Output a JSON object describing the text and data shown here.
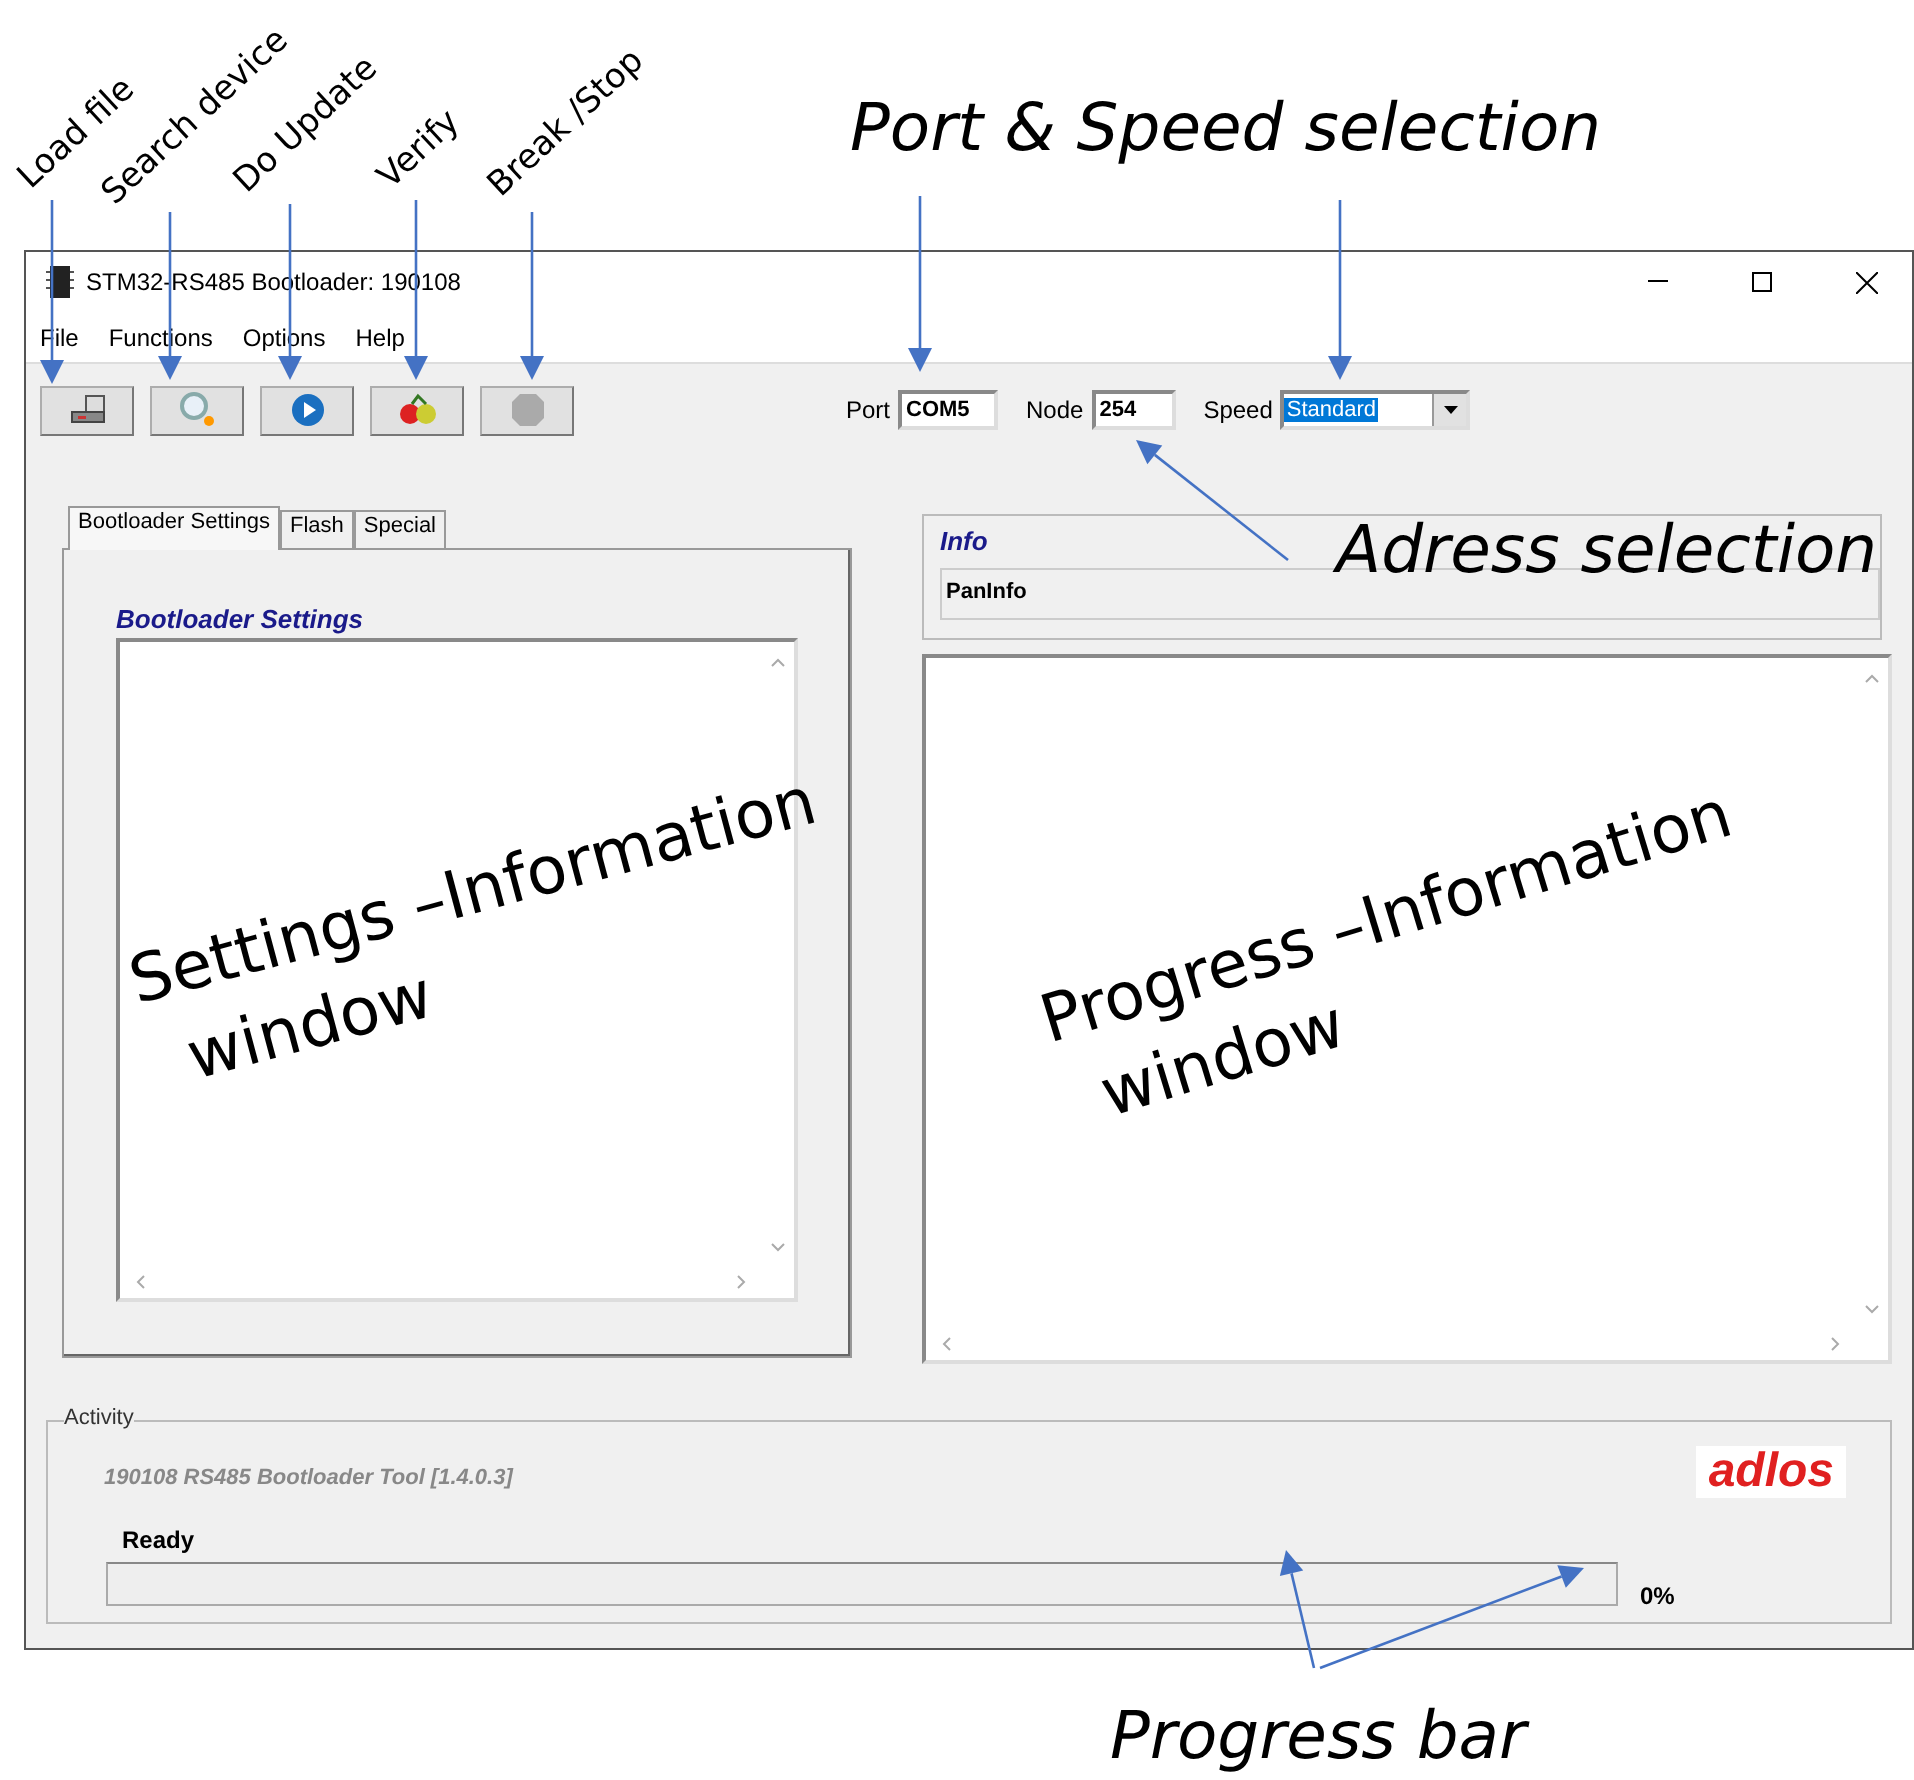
{
  "annotations": {
    "toolbar_labels": [
      "Load file",
      "Search device",
      "Do Update",
      "Verify",
      "Break /Stop"
    ],
    "port_speed": "Port & Speed selection",
    "address": "Adress selection",
    "settings_window": [
      "Settings –Information",
      "window"
    ],
    "progress_window": [
      "Progress –Information",
      "window"
    ],
    "progress_bar": "Progress bar"
  },
  "window": {
    "title": "STM32-RS485 Bootloader: 190108",
    "menu": [
      "File",
      "Functions",
      "Options",
      "Help"
    ],
    "toolbar": [
      {
        "kind": "load"
      },
      {
        "kind": "search"
      },
      {
        "kind": "play"
      },
      {
        "kind": "verify"
      },
      {
        "kind": "stop"
      }
    ],
    "connection": {
      "port_label": "Port",
      "port": "COM5",
      "node_label": "Node",
      "node": "254",
      "speed_label": "Speed",
      "speed": "Standard"
    },
    "tabs": [
      {
        "label": "Bootloader Settings",
        "selected": true
      },
      {
        "label": "Flash",
        "selected": false
      },
      {
        "label": "Special",
        "selected": false
      }
    ],
    "settings_heading": "Bootloader Settings",
    "info": {
      "heading": "Info",
      "panel": "PanInfo"
    },
    "activity": {
      "legend": "Activity",
      "version": "190108 RS485 Bootloader Tool [1.4.0.3]",
      "logo": "adlos",
      "status": "Ready",
      "level": 0,
      "percent": "0%"
    }
  }
}
